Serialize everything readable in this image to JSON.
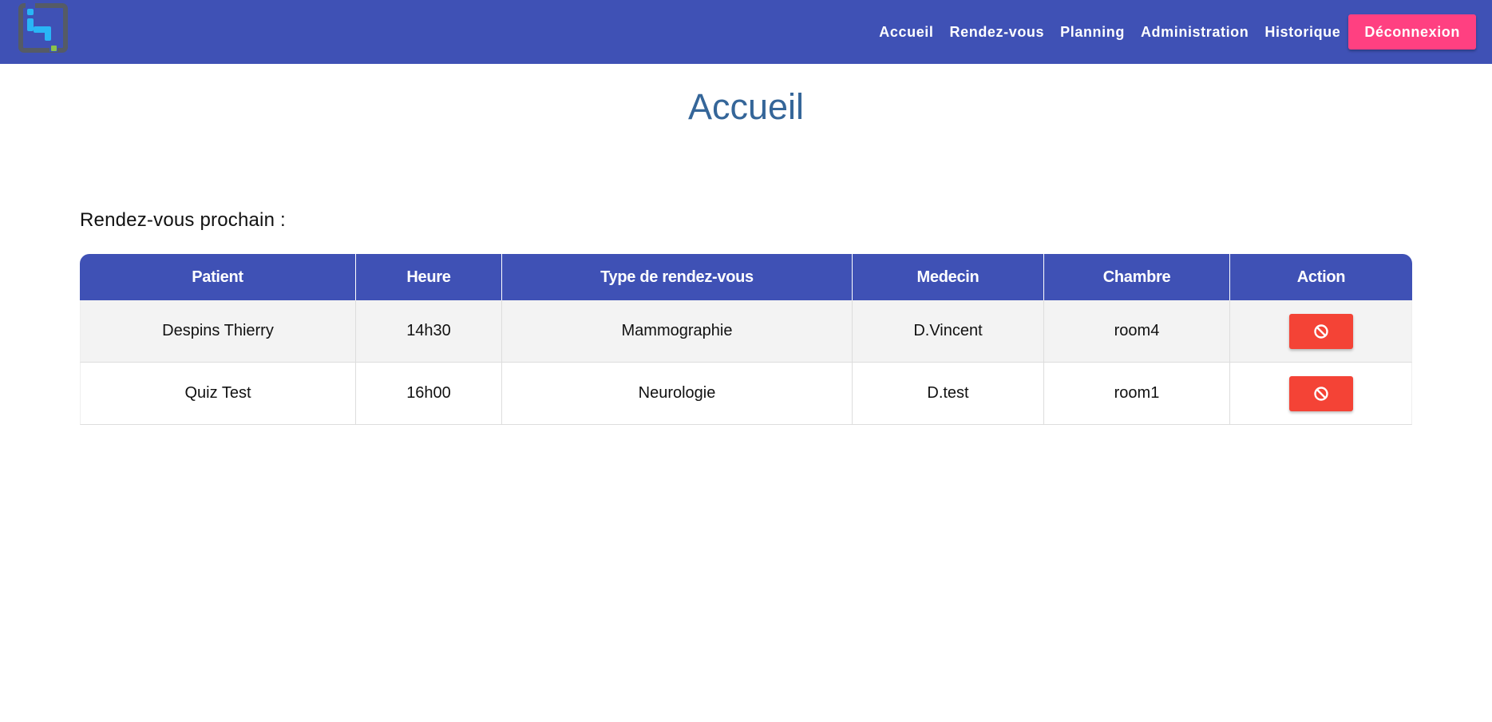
{
  "navbar": {
    "links": [
      {
        "label": "Accueil"
      },
      {
        "label": "Rendez-vous"
      },
      {
        "label": "Planning"
      },
      {
        "label": "Administration"
      },
      {
        "label": "Historique"
      }
    ],
    "logout_label": "Déconnexion",
    "bg_color": "#3f51b5",
    "logout_color": "#ff4081"
  },
  "page": {
    "title": "Accueil",
    "section_title": "Rendez-vous prochain :"
  },
  "table": {
    "columns": [
      "Patient",
      "Heure",
      "Type de rendez-vous",
      "Medecin",
      "Chambre",
      "Action"
    ],
    "rows": [
      {
        "patient": "Despins Thierry",
        "heure": "14h30",
        "type": "Mammographie",
        "medecin": "D.Vincent",
        "chambre": "room4",
        "action_icon": "ban-icon"
      },
      {
        "patient": "Quiz Test",
        "heure": "16h00",
        "type": "Neurologie",
        "medecin": "D.test",
        "chambre": "room1",
        "action_icon": "ban-icon"
      }
    ],
    "header_color": "#3f51b5",
    "action_color": "#f44336"
  }
}
